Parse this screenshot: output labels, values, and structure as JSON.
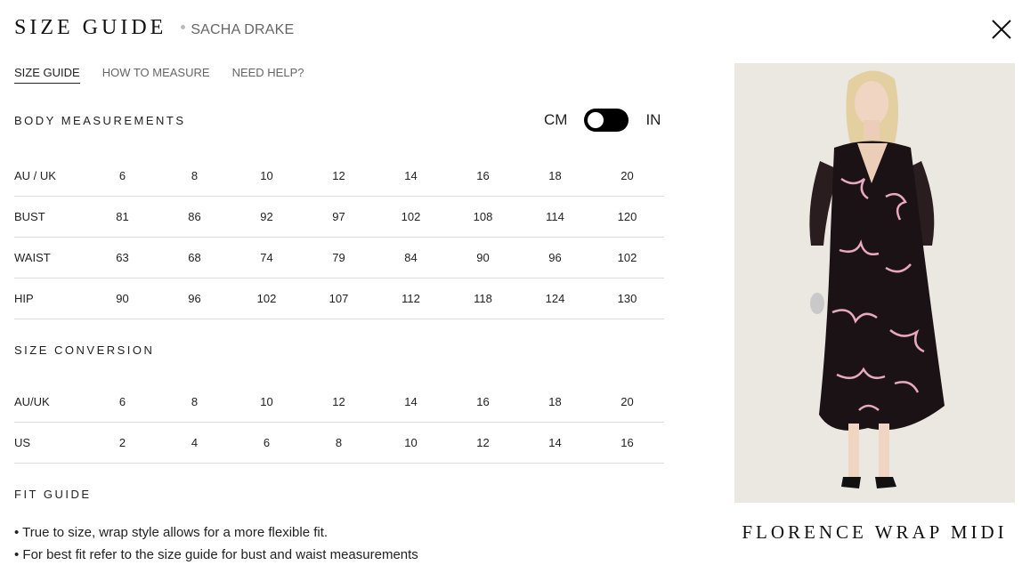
{
  "header": {
    "title": "SIZE GUIDE",
    "brand": "SACHA DRAKE"
  },
  "tabs": [
    {
      "label": "SIZE GUIDE",
      "active": true
    },
    {
      "label": "HOW TO MEASURE",
      "active": false
    },
    {
      "label": "NEED HELP?",
      "active": false
    }
  ],
  "body_measurements": {
    "title": "BODY MEASUREMENTS",
    "unit_left": "CM",
    "unit_right": "IN",
    "unit_selected": "CM",
    "rows": [
      {
        "label": "AU / UK",
        "values": [
          "6",
          "8",
          "10",
          "12",
          "14",
          "16",
          "18",
          "20"
        ]
      },
      {
        "label": "BUST",
        "values": [
          "81",
          "86",
          "92",
          "97",
          "102",
          "108",
          "114",
          "120"
        ]
      },
      {
        "label": "WAIST",
        "values": [
          "63",
          "68",
          "74",
          "79",
          "84",
          "90",
          "96",
          "102"
        ]
      },
      {
        "label": "HIP",
        "values": [
          "90",
          "96",
          "102",
          "107",
          "112",
          "118",
          "124",
          "130"
        ]
      }
    ]
  },
  "size_conversion": {
    "title": "SIZE CONVERSION",
    "rows": [
      {
        "label": "AU/UK",
        "values": [
          "6",
          "8",
          "10",
          "12",
          "14",
          "16",
          "18",
          "20"
        ]
      },
      {
        "label": "US",
        "values": [
          "2",
          "4",
          "6",
          "8",
          "10",
          "12",
          "14",
          "16"
        ]
      }
    ]
  },
  "fit_guide": {
    "title": "FIT GUIDE",
    "items": [
      "• True to size, wrap style allows for a more flexible fit.",
      "• For best fit refer to the size guide for bust and waist measurements"
    ]
  },
  "product": {
    "name": "FLORENCE WRAP MIDI",
    "icon": "model-photo"
  },
  "colors": {
    "toggle": "#000000",
    "image_bg": "#ebe7e1",
    "dress": "#1a1214",
    "print": "#e8a8c0"
  }
}
